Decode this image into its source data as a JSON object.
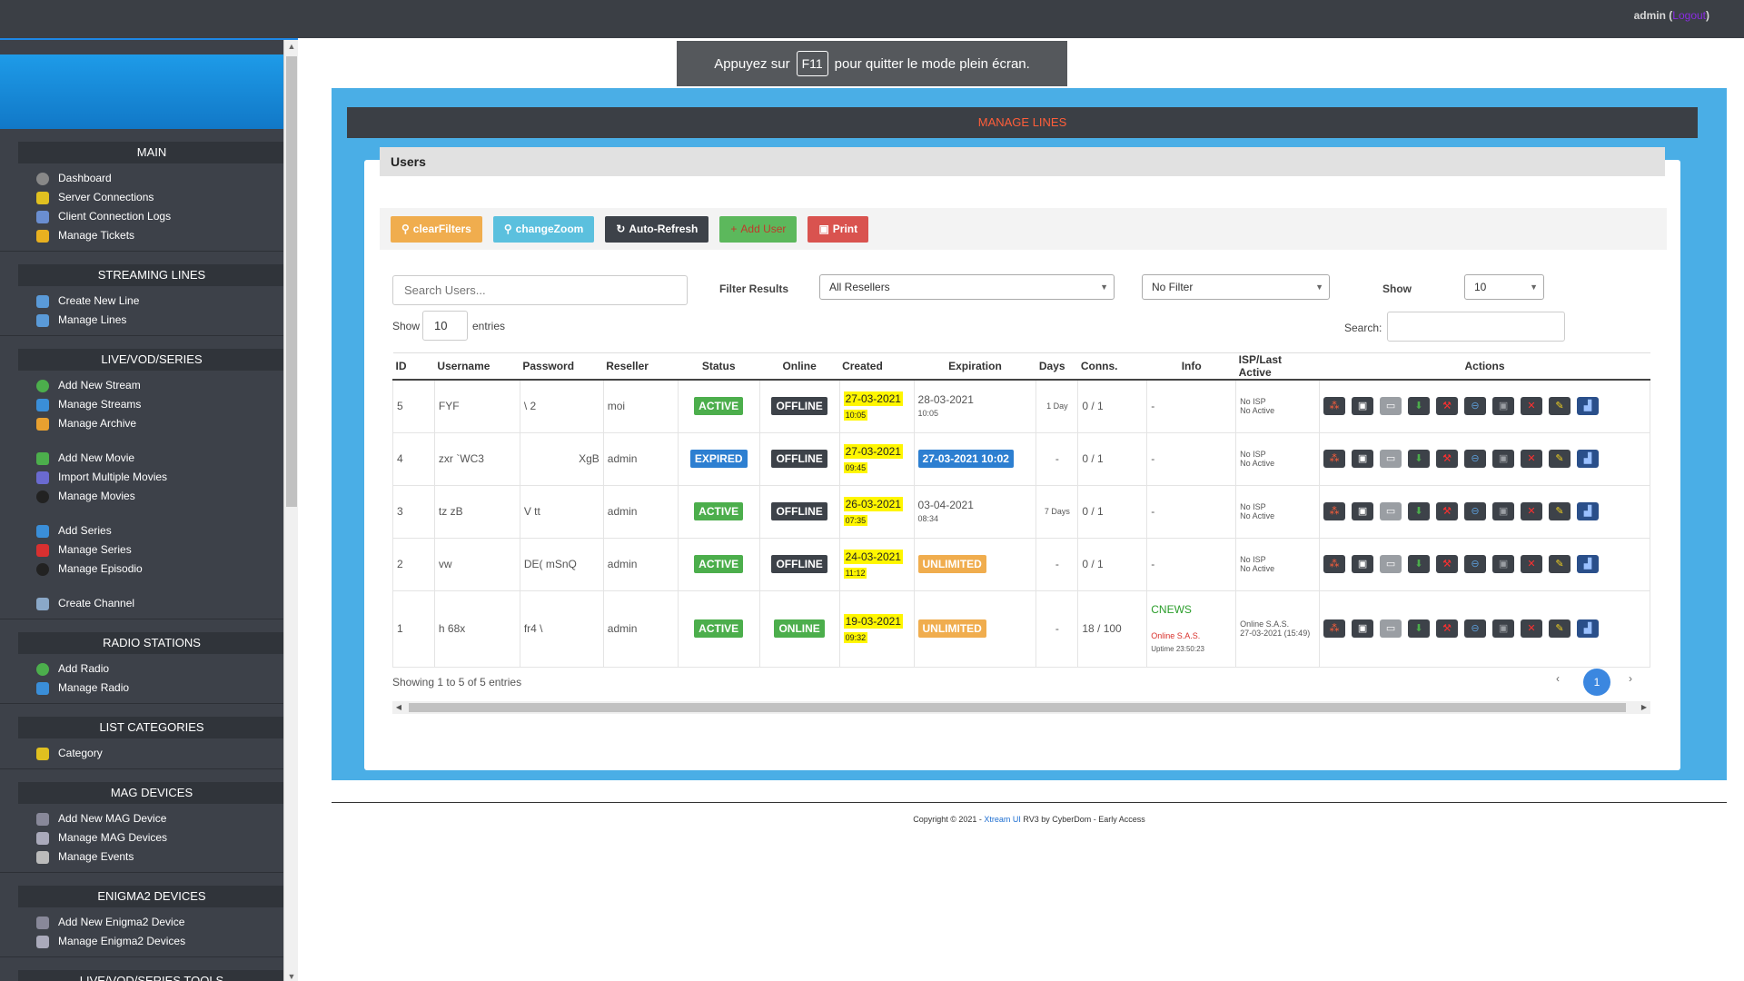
{
  "topbar": {
    "user": "admin (",
    "logout": "Logout",
    "close": ")"
  },
  "toast": {
    "before": "Appuyez sur",
    "key": "F11",
    "after": "pour quitter le mode plein écran."
  },
  "sidebar": {
    "sections": {
      "main": "MAIN",
      "streaming": "STREAMING LINES",
      "livevod": "LIVE/VOD/SERIES",
      "radio": "RADIO STATIONS",
      "categories": "LIST CATEGORIES",
      "mag": "MAG DEVICES",
      "enigma": "ENIGMA2 DEVICES",
      "tools": "LIVE/VOD/SERIES TOOLS"
    },
    "items": {
      "dashboard": "Dashboard",
      "server_connections": "Server Connections",
      "client_logs": "Client Connection Logs",
      "tickets": "Manage Tickets",
      "create_line": "Create New Line",
      "manage_lines": "Manage Lines",
      "add_stream": "Add New Stream",
      "manage_streams": "Manage Streams",
      "manage_archive": "Manage Archive",
      "add_movie": "Add New Movie",
      "import_movies": "Import Multiple Movies",
      "manage_movies": "Manage Movies",
      "add_series": "Add Series",
      "manage_series": "Manage Series",
      "manage_episodio": "Manage Episodio",
      "create_channel": "Create Channel",
      "add_radio": "Add Radio",
      "manage_radio": "Manage Radio",
      "category": "Category",
      "add_mag": "Add New MAG Device",
      "manage_mag": "Manage MAG Devices",
      "manage_events": "Manage Events",
      "add_enigma": "Add New Enigma2 Device",
      "manage_enigma": "Manage Enigma2 Devices"
    }
  },
  "page": {
    "header": "MANAGE LINES",
    "card_title": "Users"
  },
  "toolbar": {
    "clear": "clearFilters",
    "zoom": "changeZoom",
    "refresh": "Auto-Refresh",
    "add": "Add User",
    "print": "Print"
  },
  "filters": {
    "search_placeholder": "Search Users...",
    "filter_label": "Filter Results",
    "resellers": "All Resellers",
    "no_filter": "No Filter",
    "show_label": "Show",
    "show_value": "10",
    "entries_show": "Show",
    "entries_value": "10",
    "entries_label": "entries",
    "search_label": "Search:"
  },
  "columns": [
    "ID",
    "Username",
    "Password",
    "Reseller",
    "Status",
    "Online",
    "Created",
    "Expiration",
    "Days",
    "Conns.",
    "Info",
    "ISP/Last Active",
    "Actions"
  ],
  "rows": [
    {
      "id": "5",
      "username": "FYF",
      "password": "\\          2",
      "reseller": "moi",
      "status": "ACTIVE",
      "online": "OFFLINE",
      "created_date": "27-03-2021",
      "created_time": "10:05",
      "exp_date": "28-03-2021",
      "exp_time": "10:05",
      "days": "1 Day",
      "conns": "0 / 1",
      "info": "-",
      "isp1": "No ISP",
      "isp2": "No Active"
    },
    {
      "id": "4",
      "username": "zxr     `WC3",
      "password": "XgB",
      "reseller": "admin",
      "status": "EXPIRED",
      "online": "OFFLINE",
      "created_date": "27-03-2021",
      "created_time": "09:45",
      "exp_badge": "27-03-2021 10:02",
      "days": "-",
      "conns": "0 / 1",
      "info": "-",
      "isp1": "No ISP",
      "isp2": "No Active"
    },
    {
      "id": "3",
      "username": "tz     zB",
      "password": "V          tt",
      "reseller": "admin",
      "status": "ACTIVE",
      "online": "OFFLINE",
      "created_date": "26-03-2021",
      "created_time": "07:35",
      "exp_date": "03-04-2021",
      "exp_time": "08:34",
      "days": "7 Days",
      "conns": "0 / 1",
      "info": "-",
      "isp1": "No ISP",
      "isp2": "No Active"
    },
    {
      "id": "2",
      "username": "vw",
      "password": "DE(        mSnQ",
      "reseller": "admin",
      "status": "ACTIVE",
      "online": "OFFLINE",
      "created_date": "24-03-2021",
      "created_time": "11:12",
      "exp_badge": "UNLIMITED",
      "days": "-",
      "conns": "0 / 1",
      "info": "-",
      "isp1": "No ISP",
      "isp2": "No Active"
    },
    {
      "id": "1",
      "username": "h         68x",
      "password": "fr4        \\",
      "reseller": "admin",
      "status": "ACTIVE",
      "online": "ONLINE",
      "created_date": "19-03-2021",
      "created_time": "09:32",
      "exp_badge": "UNLIMITED",
      "days": "-",
      "conns": "18 / 100",
      "info_channel": "CNEWS",
      "info_isp": "Online S.A.S.",
      "info_uptime": "Uptime 23:50:23",
      "isp1": "Online S.A.S.",
      "isp2": "27-03-2021 (15:49)"
    }
  ],
  "table_footer": {
    "showing": "Showing 1 to 5 of 5 entries",
    "prev": "‹",
    "page": "1",
    "next": "›"
  },
  "footer": {
    "text1": "Copyright © 2021 - ",
    "brand": "Xtream UI",
    "text2": " RV3 by CyberDom - Early Access"
  },
  "colors": {
    "accent_blue": "#4aaee6",
    "header_red": "#ff5e3a",
    "active": "#4cae4c",
    "expired": "#2d7fd1",
    "unlimited": "#f0ad4e",
    "highlight": "#fff600"
  }
}
